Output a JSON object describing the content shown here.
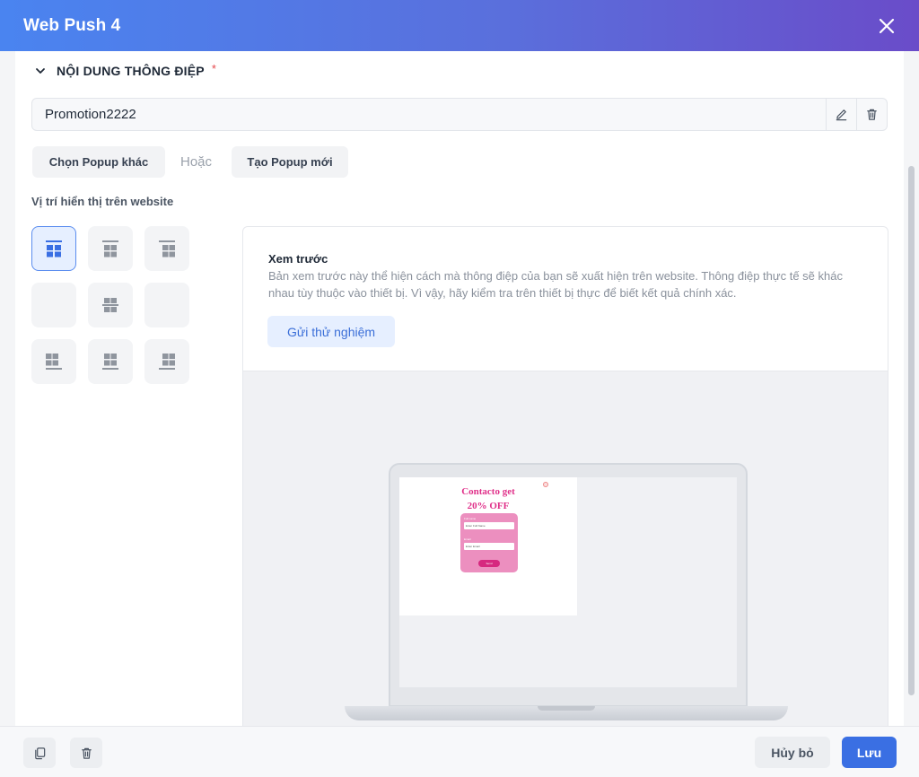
{
  "dialog": {
    "title": "Web Push 4"
  },
  "section": {
    "title": "NỘI DUNG THÔNG ĐIỆP",
    "required_mark": "*"
  },
  "popup_name": {
    "value": "Promotion2222"
  },
  "actions": {
    "choose_other": "Chọn Popup khác",
    "or": "Hoặc",
    "create_new": "Tạo Popup mới"
  },
  "position": {
    "label": "Vị trí hiển thị trên website",
    "selected": "top-left",
    "cells": [
      "top-left",
      "top-center",
      "top-right",
      "middle-left",
      "middle-center",
      "middle-right",
      "bottom-left",
      "bottom-center",
      "bottom-right"
    ]
  },
  "preview": {
    "title": "Xem trước",
    "description": "Bản xem trước này thể hiện cách mà thông điệp của bạn sẽ xuất hiện trên website. Thông điệp thực tế sẽ khác nhau tùy thuộc vào thiết bị. Vì vậy, hãy kiểm tra trên thiết bị thực để biết kết quả chính xác.",
    "test_button": "Gửi thử nghiệm",
    "popup_mock": {
      "line1": "Contacto get",
      "line2": "20% OFF",
      "name_label": "Full name",
      "name_placeholder": "Enter Full Name",
      "email_label": "Email",
      "email_placeholder": "Enter Email",
      "send": "Send"
    }
  },
  "footer": {
    "cancel": "Hủy bỏ",
    "save": "Lưu"
  },
  "colors": {
    "primary": "#3a6fe3",
    "header_start": "#4a84f0",
    "header_end": "#6a4cc9",
    "accent_pink": "#e0318a"
  }
}
